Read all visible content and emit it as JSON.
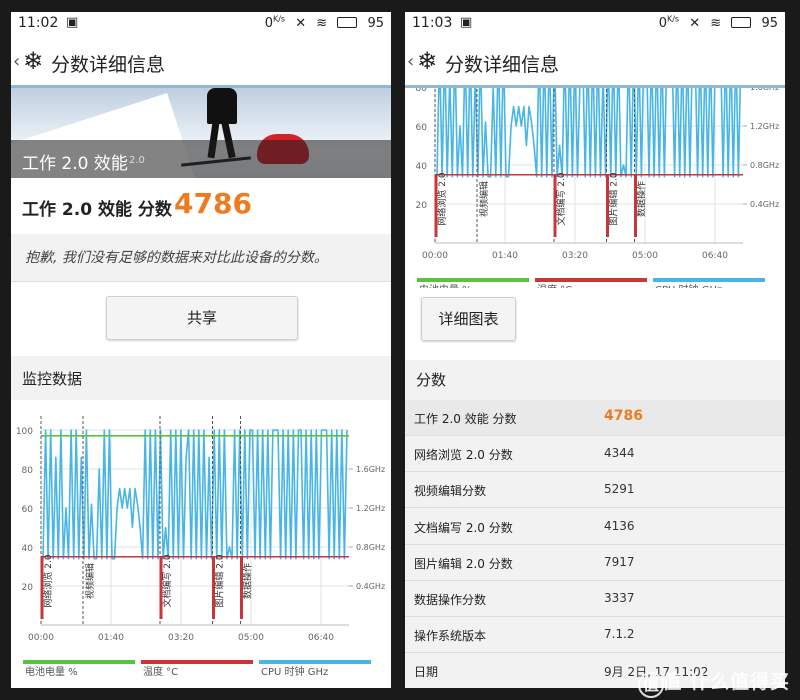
{
  "status": {
    "time_left": "11:02",
    "time_right": "11:03",
    "net_speed": "0",
    "net_unit": "K/s",
    "battery": "95"
  },
  "header": {
    "back": "‹",
    "title": "分数详细信息"
  },
  "hero": {
    "title": "工作 2.0 效能",
    "version": "2.0"
  },
  "score": {
    "label": "工作 2.0 效能 分数",
    "value": "4786"
  },
  "notice": "抱歉, 我们没有足够的数据来对比此设备的分数。",
  "share_button": "共享",
  "monitor_title": "监控数据",
  "detail_button": "详细图表",
  "scores_title": "分数",
  "colors": {
    "accent": "#f07a1f",
    "battery": "#5ac33c",
    "temp": "#c9363a",
    "cpu": "#47b5e6"
  },
  "chart_data": {
    "type": "line",
    "x_ticks": [
      "00:00",
      "01:40",
      "03:20",
      "05:00",
      "06:40"
    ],
    "y_left_ticks": [
      "20",
      "40",
      "60",
      "80",
      "100"
    ],
    "y_right_ticks": [
      "0.4GHz",
      "0.8GHz",
      "1.2GHz",
      "1.6GHz"
    ],
    "ylim_left": [
      0,
      100
    ],
    "ylim_right": [
      0,
      2.0
    ],
    "phases": [
      {
        "label": "网络浏览 2.0",
        "start": "00:00",
        "end": "01:00"
      },
      {
        "label": "视频编辑",
        "start": "01:00",
        "end": "02:50"
      },
      {
        "label": "文档编写 2.0",
        "start": "02:50",
        "end": "04:05"
      },
      {
        "label": "图片编辑 2.0",
        "start": "04:05",
        "end": "04:45"
      },
      {
        "label": "数据操作",
        "start": "04:45",
        "end": "07:20"
      }
    ],
    "series": [
      {
        "name": "电池电量 %",
        "color": "#5ac33c",
        "axis": "left",
        "values": [
          97,
          97
        ]
      },
      {
        "name": "温度 °C",
        "color": "#c9363a",
        "axis": "left",
        "values": [
          35,
          35
        ]
      },
      {
        "name": "CPU 时钟 GHz",
        "color": "#47b5e6",
        "axis": "left",
        "values": [
          34,
          100,
          34,
          100,
          34,
          86,
          34,
          100,
          34,
          60,
          34,
          100,
          34,
          100,
          34,
          86,
          34,
          100,
          34,
          62,
          34,
          34,
          80,
          34,
          100,
          34,
          100,
          34,
          34,
          60,
          70,
          60,
          70,
          60,
          70,
          50,
          70,
          62,
          50,
          34,
          100,
          34,
          100,
          34,
          100,
          34,
          100,
          34,
          50,
          34,
          100,
          34,
          100,
          34,
          100,
          34,
          86,
          100,
          34,
          100,
          34,
          100,
          34,
          100,
          34,
          86,
          34,
          100,
          34,
          100,
          34,
          100,
          34,
          40,
          34,
          100,
          34,
          100,
          34,
          100,
          34,
          100,
          100,
          34,
          100,
          34,
          100,
          34,
          100,
          34,
          100,
          100,
          100,
          34,
          100,
          34,
          100,
          34,
          100,
          34,
          100,
          100,
          34,
          100,
          34,
          100,
          34,
          100,
          34,
          100,
          100,
          100,
          34,
          100,
          34,
          100,
          34,
          100,
          34,
          100
        ]
      }
    ]
  },
  "score_rows": [
    {
      "label": "工作 2.0 效能 分数",
      "value": "4786"
    },
    {
      "label": "网络浏览 2.0 分数",
      "value": "4344"
    },
    {
      "label": "视频编辑分数",
      "value": "5291"
    },
    {
      "label": "文档编写 2.0 分数",
      "value": "4136"
    },
    {
      "label": "图片编辑 2.0 分数",
      "value": "7917"
    },
    {
      "label": "数据操作分数",
      "value": "3337"
    },
    {
      "label": "操作系统版本",
      "value": "7.1.2"
    },
    {
      "label": "日期",
      "value": "9月 2日, 17 11:02"
    }
  ],
  "watermark": "值 什么值得买"
}
